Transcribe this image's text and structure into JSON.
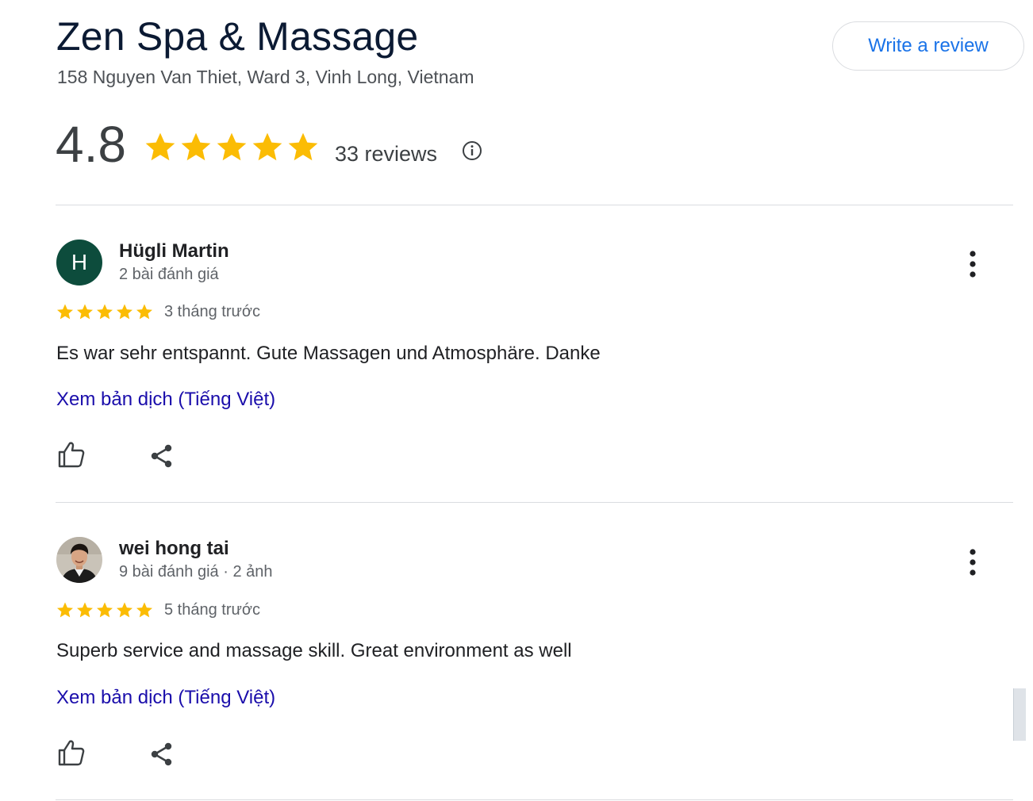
{
  "business": {
    "name": "Zen Spa & Massage",
    "address": "158 Nguyen Van Thiet, Ward 3, Vinh Long, Vietnam",
    "write_review_label": "Write a review",
    "rating": "4.8",
    "rating_value": 4.8,
    "rating_max": 5,
    "review_count": "33 reviews"
  },
  "colors": {
    "star": "#fbbc04",
    "link": "#1a0dab",
    "button_text": "#1a73e8",
    "avatar_h": "#0d4c3c"
  },
  "reviews": [
    {
      "avatar_type": "letter",
      "avatar_letter": "H",
      "name": "Hügli Martin",
      "meta": "2 bài đánh giá",
      "stars": 5,
      "time": "3 tháng trước",
      "text": "Es war sehr entspannt. Gute Massagen und Atmosphäre. Danke",
      "translate_label": "Xem bản dịch (Tiếng Việt)",
      "like_icon": "thumbs-up-icon",
      "share_icon": "share-icon",
      "more_icon": "more-vertical-icon"
    },
    {
      "avatar_type": "photo",
      "name": "wei hong tai",
      "meta": "9 bài đánh giá · 2 ảnh",
      "stars": 5,
      "time": "5 tháng trước",
      "text": "Superb service and massage skill. Great environment as well",
      "translate_label": "Xem bản dịch (Tiếng Việt)",
      "like_icon": "thumbs-up-icon",
      "share_icon": "share-icon",
      "more_icon": "more-vertical-icon"
    }
  ]
}
